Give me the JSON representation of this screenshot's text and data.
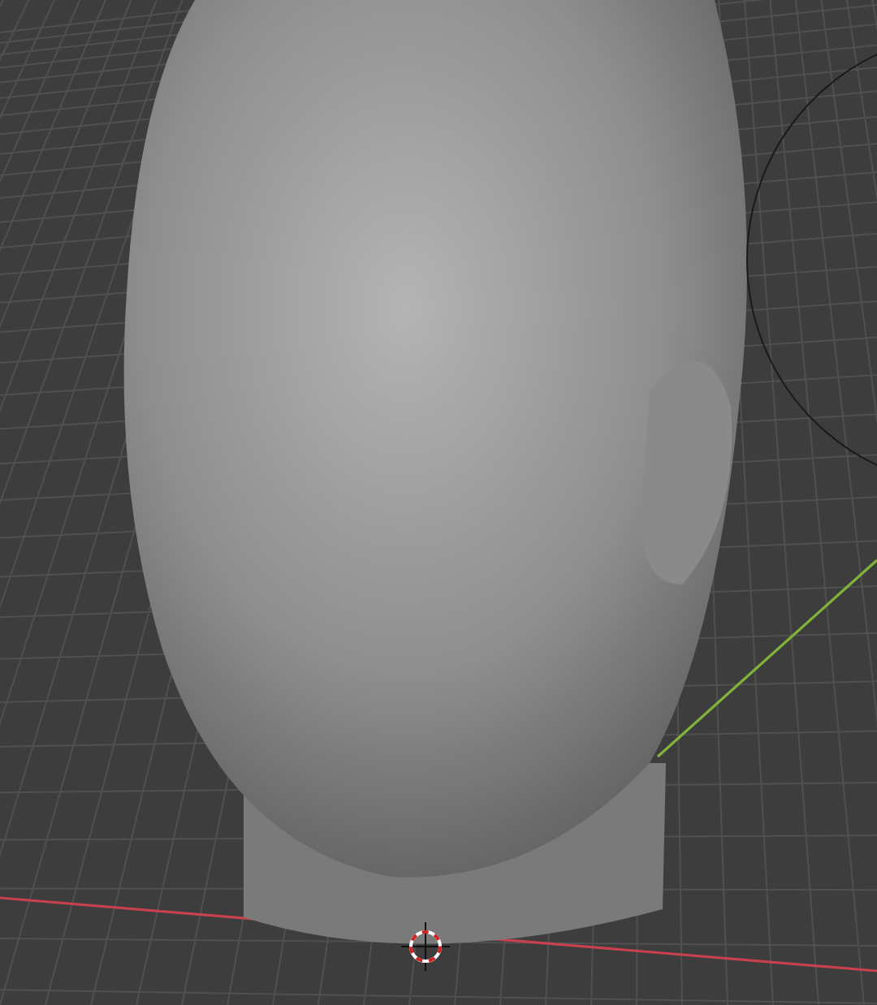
{
  "viewport": {
    "show_grid": true,
    "show_axes": true,
    "show_cursor": true,
    "show_brush": true
  }
}
